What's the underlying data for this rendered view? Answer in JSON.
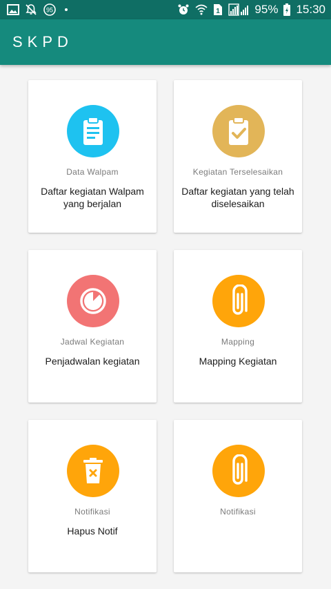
{
  "status_bar": {
    "battery_percent": "95%",
    "time": "15:30",
    "badge_number": "95",
    "sim_label": "1",
    "icons": [
      "image-icon",
      "notifications-off-icon",
      "data-saver-icon",
      "alarm-icon",
      "wifi-icon",
      "sim-icon",
      "signal-icon",
      "battery-icon"
    ]
  },
  "app_bar": {
    "title": "SKPD",
    "background": "#158a7d",
    "status_background": "#0f6e64"
  },
  "menu": [
    {
      "label": "Data Walpam",
      "description": "Daftar kegiatan Walpam yang berjalan",
      "icon": "clipboard-list-icon",
      "color": "#1ec2f0"
    },
    {
      "label": "Kegiatan Terselesaikan",
      "description": "Daftar kegiatan yang telah diselesaikan",
      "icon": "clipboard-check-icon",
      "color": "#e2b558"
    },
    {
      "label": "Jadwal Kegiatan",
      "description": "Penjadwalan kegiatan",
      "icon": "timer-icon",
      "color": "#f27474"
    },
    {
      "label": "Mapping",
      "description": "Mapping Kegiatan",
      "icon": "paperclip-icon",
      "color": "#ffa50a"
    },
    {
      "label": "Notifikasi",
      "description": "Hapus Notif",
      "icon": "trash-icon",
      "color": "#ffa50a"
    },
    {
      "label": "Notifikasi",
      "description": "",
      "icon": "paperclip-icon",
      "color": "#ffa50a"
    }
  ]
}
